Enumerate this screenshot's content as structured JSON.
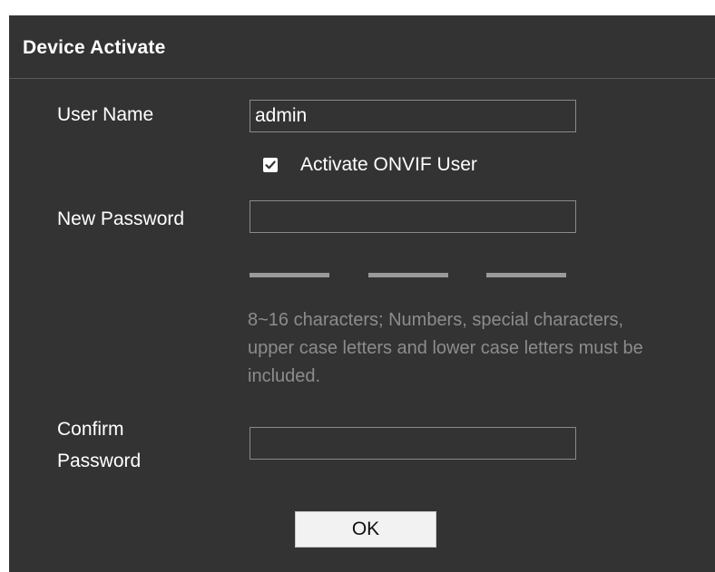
{
  "dialog": {
    "title": "Device Activate"
  },
  "form": {
    "username_label": "User Name",
    "username_value": "admin",
    "onvif_checkbox_label": "Activate ONVIF User",
    "onvif_checked": true,
    "new_password_label": "New Password",
    "new_password_value": "",
    "password_strength_segments": 3,
    "password_hint": "8~16 characters; Numbers, special characters, upper case letters and lower case letters must be included.",
    "confirm_password_label_line1": "Confirm",
    "confirm_password_label_line2": "Password",
    "confirm_password_value": "",
    "ok_label": "OK"
  },
  "colors": {
    "background": "#333333",
    "text": "#ffffff",
    "hint_text": "#8c8c8c",
    "strength_bar_inactive": "#9a9a9a",
    "button_bg": "#f2f2f2"
  }
}
